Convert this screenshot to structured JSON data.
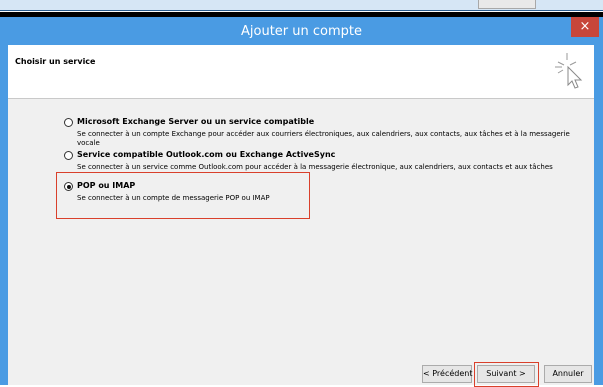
{
  "dialog": {
    "title": "Ajouter un compte",
    "close_glyph": "×",
    "header_title": "Choisir un service"
  },
  "options": [
    {
      "label": "Microsoft Exchange Server ou un service compatible",
      "description": "Se connecter à un compte Exchange pour accéder aux courriers électroniques, aux calendriers, aux contacts, aux tâches et à la messagerie vocale",
      "selected": false
    },
    {
      "label": "Service compatible Outlook.com ou Exchange ActiveSync",
      "description": "Se connecter à un service comme Outlook.com pour accéder à la messagerie électronique, aux calendriers, aux contacts et aux tâches",
      "selected": false
    },
    {
      "label": "POP ou IMAP",
      "description": "Se connecter à un compte de messagerie POP ou IMAP",
      "selected": true
    }
  ],
  "buttons": {
    "previous": "< Précédent",
    "next": "Suivant >",
    "cancel": "Annuler"
  },
  "colors": {
    "titlebar": "#4a9be3",
    "close": "#c7463a",
    "highlight": "#d9402b"
  },
  "icons": {
    "header": "cursor-click-icon",
    "close": "close-icon"
  }
}
